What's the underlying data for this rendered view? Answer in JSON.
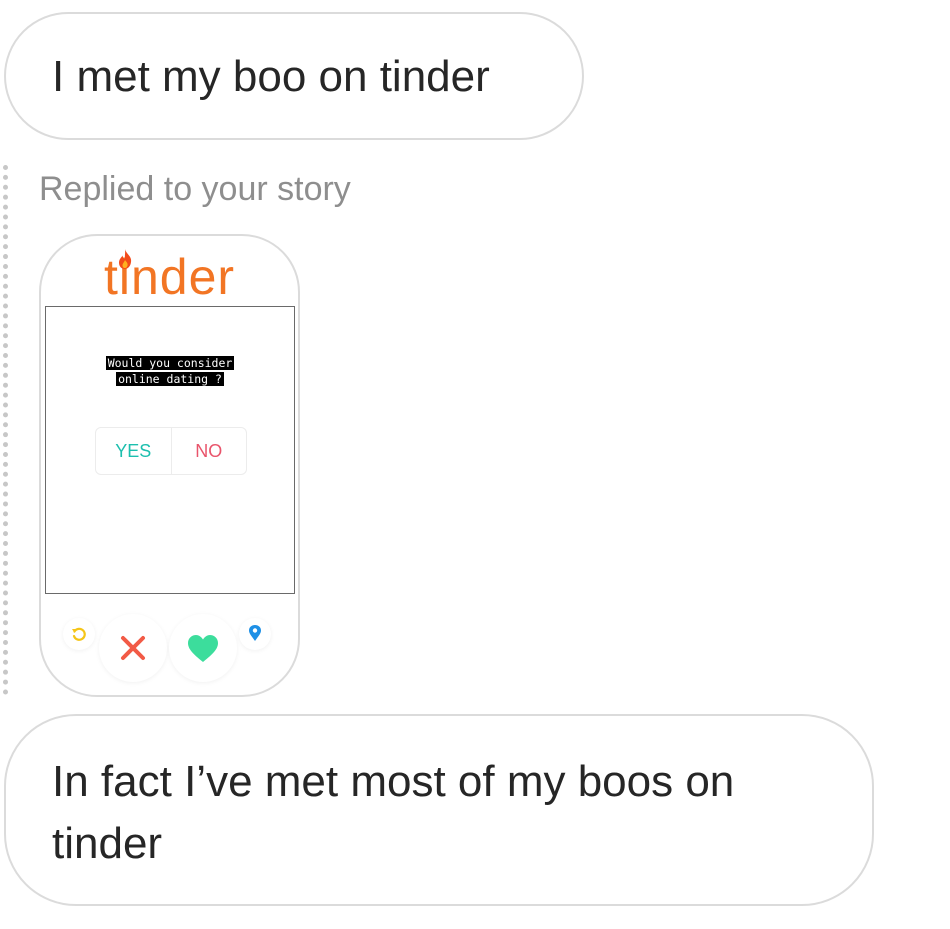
{
  "messages": {
    "first": "I met my boo on tinder",
    "second": "In fact I’ve met most of my boos on tinder"
  },
  "reply": {
    "label": "Replied to your story"
  },
  "story": {
    "logo_text": "tinder",
    "logo_color": "#f27524",
    "poll": {
      "question_line1": "Would you consider",
      "question_line2": "online dating ?",
      "options": [
        "YES",
        "NO"
      ],
      "yes_color": "#1cbfae",
      "no_color": "#e9546b"
    },
    "actions": {
      "rewind_icon": "rewind-icon",
      "nope_icon": "close-icon",
      "like_icon": "heart-icon",
      "location_icon": "location-pin-icon"
    }
  },
  "colors": {
    "bubble_border": "#dbdbdb",
    "secondary_text": "#8e8e8e"
  }
}
